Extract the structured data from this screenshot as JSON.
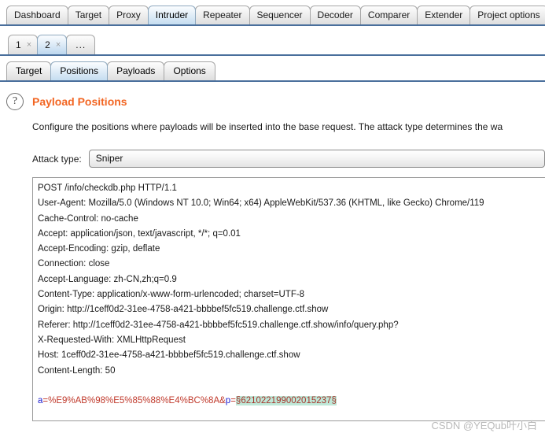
{
  "main_tabs": [
    {
      "label": "Dashboard",
      "active": false
    },
    {
      "label": "Target",
      "active": false
    },
    {
      "label": "Proxy",
      "active": false
    },
    {
      "label": "Intruder",
      "active": true
    },
    {
      "label": "Repeater",
      "active": false
    },
    {
      "label": "Sequencer",
      "active": false
    },
    {
      "label": "Decoder",
      "active": false
    },
    {
      "label": "Comparer",
      "active": false
    },
    {
      "label": "Extender",
      "active": false
    },
    {
      "label": "Project options",
      "active": false
    }
  ],
  "attack_tabs": [
    {
      "label": "1",
      "close": "×",
      "active": false
    },
    {
      "label": "2",
      "close": "×",
      "active": true
    },
    {
      "label": "...",
      "close": "",
      "active": false
    }
  ],
  "sub_tabs": [
    {
      "label": "Target",
      "active": false
    },
    {
      "label": "Positions",
      "active": true
    },
    {
      "label": "Payloads",
      "active": false
    },
    {
      "label": "Options",
      "active": false
    }
  ],
  "section": {
    "help_glyph": "?",
    "title": "Payload Positions",
    "description": "Configure the positions where payloads will be inserted into the base request. The attack type determines the wa"
  },
  "attack_type": {
    "label": "Attack type:",
    "value": "Sniper"
  },
  "request": {
    "lines": [
      "POST /info/checkdb.php HTTP/1.1",
      "User-Agent: Mozilla/5.0 (Windows NT 10.0; Win64; x64) AppleWebKit/537.36 (KHTML, like Gecko) Chrome/119",
      "Cache-Control: no-cache",
      "Accept: application/json, text/javascript, */*; q=0.01",
      "Accept-Encoding: gzip, deflate",
      "Connection: close",
      "Accept-Language: zh-CN,zh;q=0.9",
      "Content-Type: application/x-www-form-urlencoded; charset=UTF-8",
      "Origin: http://1ceff0d2-31ee-4758-a421-bbbbef5fc519.challenge.ctf.show",
      "Referer: http://1ceff0d2-31ee-4758-a421-bbbbef5fc519.challenge.ctf.show/info/query.php?",
      "X-Requested-With: XMLHttpRequest",
      "Host: 1ceff0d2-31ee-4758-a421-bbbbef5fc519.challenge.ctf.show",
      "Content-Length: 50"
    ],
    "body": {
      "param_name": "a",
      "equals": "=",
      "value_before": "%E9%AB%98%E5%85%88%E4%BC%8A&",
      "param2_name": "p",
      "equals2": "=",
      "marker_open": "§",
      "payload": "621022199002015237",
      "marker_close": "§"
    }
  },
  "watermark": "CSDN @YEQub叶小白",
  "colors": {
    "accent_orange": "#f26522",
    "active_tab_blue": "#c5ddf0",
    "tab_underline": "#4a6f9c",
    "marker_highlight": "#bfe8d8",
    "request_text_red": "#c0392b",
    "param_blue": "#1b1bd0"
  }
}
